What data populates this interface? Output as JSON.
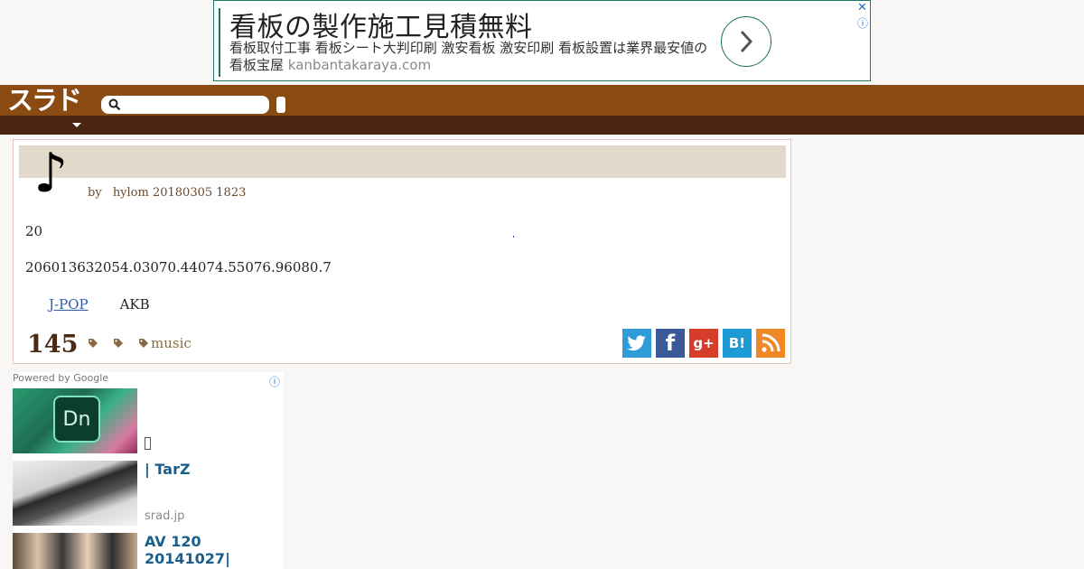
{
  "ad_top": {
    "title": "看板の製作施工見積無料",
    "description": "看板取付工事 看板シート大判印刷 激安看板 激安印刷 看板設置は業界最安値の看板宝屋",
    "domain": "kanbantakaraya.com",
    "close": "✕",
    "info": "ⓘ",
    "arrow_icon": "chevron-right-icon"
  },
  "header": {
    "logo": "スラド",
    "search_placeholder": "",
    "search_icon": "search-icon"
  },
  "article": {
    "topic_glyph": "♪",
    "by": "by",
    "author_date": "hylom 20180305 1823",
    "paragraph1": "20",
    "paragraph2": "206013632054.03070.44074.55076.96080.7",
    "link_text": "J-POP",
    "link_after": "AKB",
    "comment_count": "145",
    "tags": [
      "",
      "",
      "music"
    ],
    "share": [
      "twitter-icon",
      "facebook-icon",
      "googleplus-icon",
      "hatena-bookmark-icon",
      "rss-icon"
    ]
  },
  "google_widget": {
    "powered_by": "Powered by Google",
    "info": "ⓘ",
    "items": [
      {
        "title": "",
        "source": "",
        "thumb_text": "Dn"
      },
      {
        "title": "| TarZ",
        "source": "srad.jp"
      },
      {
        "title": "AV 120 20141027|",
        "source": ""
      }
    ]
  },
  "colors": {
    "header_brown": "#8a4b12",
    "subbar_dark": "#4a2610",
    "titlebar": "#e3d9cb",
    "link_blue": "#2a5db0"
  }
}
